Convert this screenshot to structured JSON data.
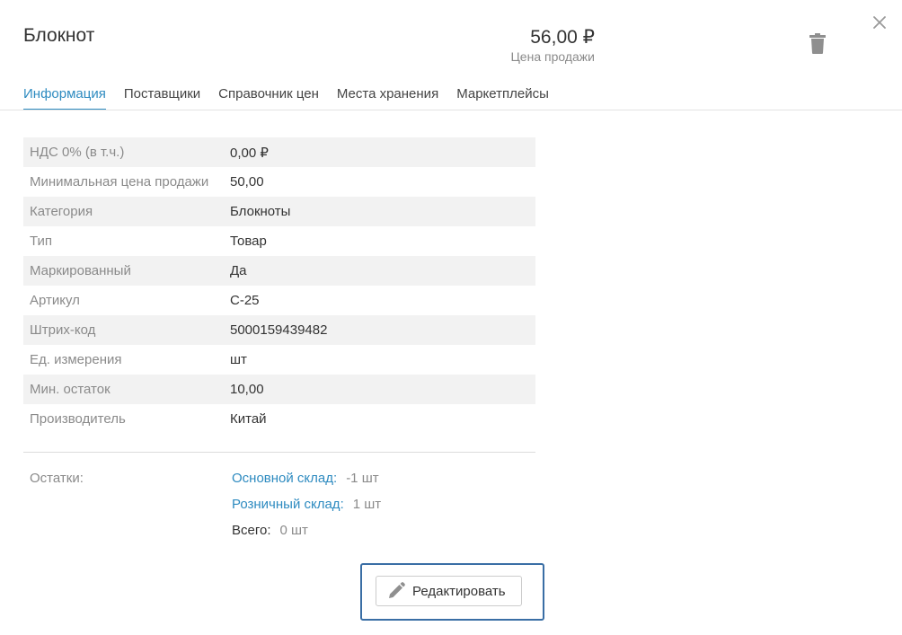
{
  "header": {
    "title": "Блокнот",
    "price": "56,00 ₽",
    "price_label": "Цена продажи",
    "close_icon": "close-icon",
    "delete_icon": "trash-icon"
  },
  "tabs": [
    {
      "label": "Информация",
      "active": true
    },
    {
      "label": "Поставщики",
      "active": false
    },
    {
      "label": "Справочник цен",
      "active": false
    },
    {
      "label": "Места хранения",
      "active": false
    },
    {
      "label": "Маркетплейсы",
      "active": false
    }
  ],
  "properties": [
    {
      "label": "НДС 0% (в т.ч.)",
      "value": "0,00 ₽"
    },
    {
      "label": "Минимальная цена продажи",
      "value": "50,00"
    },
    {
      "label": "Категория",
      "value": "Блокноты"
    },
    {
      "label": "Тип",
      "value": "Товар"
    },
    {
      "label": "Маркированный",
      "value": "Да"
    },
    {
      "label": "Артикул",
      "value": "С-25"
    },
    {
      "label": "Штрих-код",
      "value": "5000159439482"
    },
    {
      "label": "Ед. измерения",
      "value": "шт"
    },
    {
      "label": "Мин. остаток",
      "value": "10,00"
    },
    {
      "label": "Производитель",
      "value": "Китай"
    }
  ],
  "stock": {
    "label": "Остатки:",
    "items": [
      {
        "warehouse": "Основной склад:",
        "qty": "-1 шт"
      },
      {
        "warehouse": "Розничный склад:",
        "qty": "1 шт"
      }
    ],
    "total_label": "Всего:",
    "total_qty": "0 шт"
  },
  "actions": {
    "edit_label": "Редактировать",
    "edit_icon": "pencil-icon"
  },
  "colors": {
    "accent": "#2e8bc0",
    "focus": "#3a6ea5",
    "row_stripe": "#f2f2f2"
  }
}
